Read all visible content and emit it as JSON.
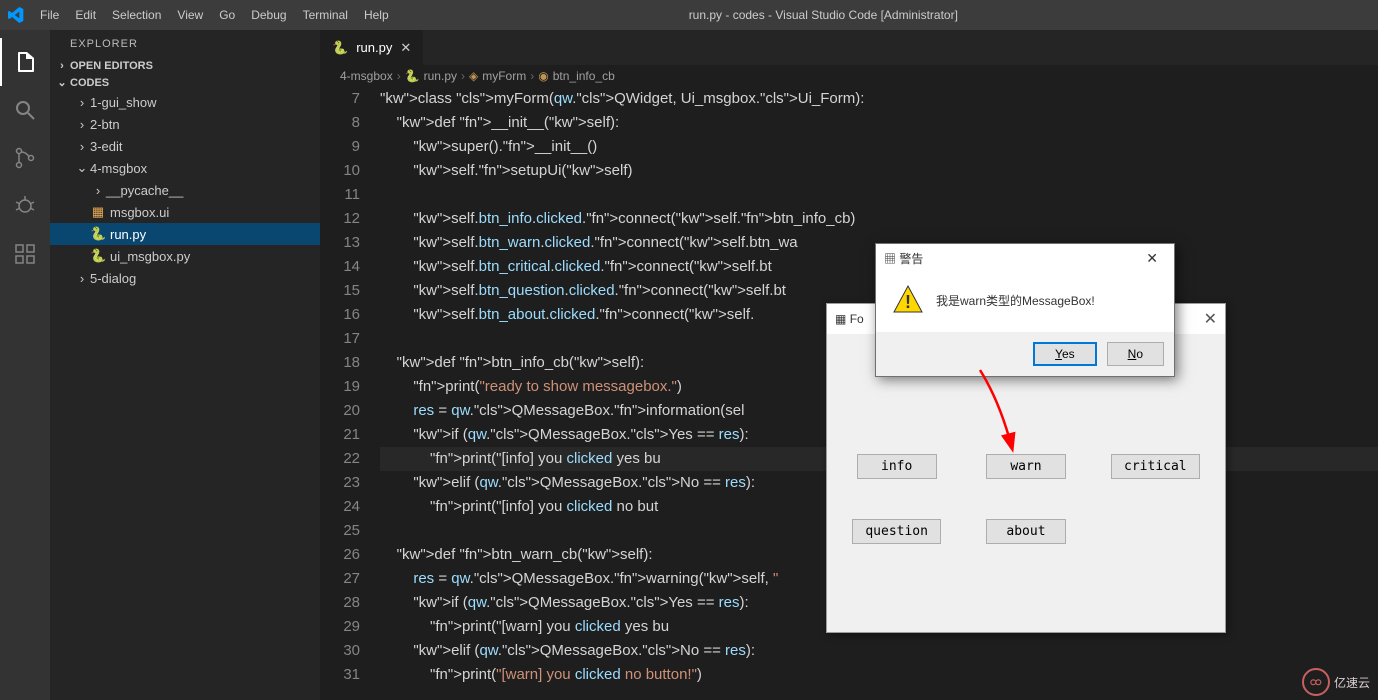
{
  "titlebar": {
    "menus": [
      "File",
      "Edit",
      "Selection",
      "View",
      "Go",
      "Debug",
      "Terminal",
      "Help"
    ],
    "title": "run.py - codes - Visual Studio Code [Administrator]"
  },
  "sidebar": {
    "title": "EXPLORER",
    "sections": [
      "OPEN EDITORS",
      "CODES"
    ],
    "tree": {
      "folders_collapsed": [
        "1-gui_show",
        "2-btn",
        "3-edit"
      ],
      "folder_open": "4-msgbox",
      "children": [
        "__pycache__",
        "msgbox.ui",
        "run.py",
        "ui_msgbox.py"
      ],
      "after": [
        "5-dialog"
      ]
    }
  },
  "tab": {
    "label": "run.py"
  },
  "breadcrumb": [
    "4-msgbox",
    "run.py",
    "myForm",
    "btn_info_cb"
  ],
  "gutter_start": 7,
  "gutter_end": 31,
  "code_lines": [
    {
      "n": 7,
      "t": "class myForm(qw.QWidget, Ui_msgbox.Ui_Form):",
      "cls": "dim"
    },
    {
      "n": 8,
      "t": "    def __init__(self):"
    },
    {
      "n": 9,
      "t": "        super().__init__()"
    },
    {
      "n": 10,
      "t": "        self.setupUi(self)"
    },
    {
      "n": 11,
      "t": ""
    },
    {
      "n": 12,
      "t": "        self.btn_info.clicked.connect(self.btn_info_cb)"
    },
    {
      "n": 13,
      "t": "        self.btn_warn.clicked.connect(self.btn_wa"
    },
    {
      "n": 14,
      "t": "        self.btn_critical.clicked.connect(self.bt"
    },
    {
      "n": 15,
      "t": "        self.btn_question.clicked.connect(self.bt"
    },
    {
      "n": 16,
      "t": "        self.btn_about.clicked.connect(self."
    },
    {
      "n": 17,
      "t": ""
    },
    {
      "n": 18,
      "t": "    def btn_info_cb(self):"
    },
    {
      "n": 19,
      "t": "        print(\"ready to show messagebox.\")"
    },
    {
      "n": 20,
      "t": "        res = qw.QMessageBox.information(sel                            w.QMessageBox.Ye"
    },
    {
      "n": 21,
      "t": "        if (qw.QMessageBox.Yes == res):"
    },
    {
      "n": 22,
      "t": "            print(\"[info] you clicked yes bu"
    },
    {
      "n": 23,
      "t": "        elif (qw.QMessageBox.No == res):"
    },
    {
      "n": 24,
      "t": "            print(\"[info] you clicked no but"
    },
    {
      "n": 25,
      "t": ""
    },
    {
      "n": 26,
      "t": "    def btn_warn_cb(self):"
    },
    {
      "n": 27,
      "t": "        res = qw.QMessageBox.warning(self, \"                            essageBox.Yes | "
    },
    {
      "n": 28,
      "t": "        if (qw.QMessageBox.Yes == res):"
    },
    {
      "n": 29,
      "t": "            print(\"[warn] you clicked yes bu"
    },
    {
      "n": 30,
      "t": "        elif (qw.QMessageBox.No == res):"
    },
    {
      "n": 31,
      "t": "            print(\"[warn] you clicked no button!\")"
    }
  ],
  "form": {
    "title": "Fo",
    "buttons": [
      "info",
      "warn",
      "critical",
      "question",
      "about"
    ]
  },
  "msgbox": {
    "title": "警告",
    "text": "我是warn类型的MessageBox!",
    "yes": "Yes",
    "no": "No"
  },
  "watermark": "亿速云"
}
